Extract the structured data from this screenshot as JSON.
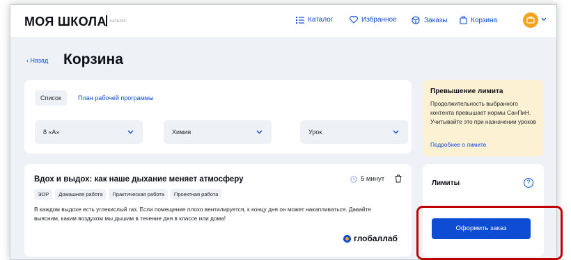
{
  "header": {
    "logo": "МОЯ ШКОЛА",
    "logo_sub": "КАТАЛОГ",
    "nav": {
      "catalog": "Каталог",
      "favorites": "Избранное",
      "orders": "Заказы",
      "cart": "Корзина"
    }
  },
  "page": {
    "back": "Назад",
    "title": "Корзина"
  },
  "filters": {
    "tabs": [
      "Список",
      "План рабочей программы"
    ],
    "selects": [
      "8 «А»",
      "Химия",
      "Урок"
    ]
  },
  "warning": {
    "title": "Превышение лимита",
    "text": "Продолжительность выбранного контента превышает нормы СанПиН. Учитывайте это при назначении уроков",
    "link": "Подробнее о лимите"
  },
  "lesson": {
    "title": "Вдох и выдох: как наше дыхание меняет атмосферу",
    "duration": "5 минут",
    "tags": [
      "ЭОР",
      "Домашняя работа",
      "Практическая работа",
      "Проектная работа"
    ],
    "description": "В каждом выдохе есть углекислый газ. Если помещение плохо вентилируется, к концу дня он может накапливаться. Давайте выясним, каким воздухом мы дышим в течение дня в классе или дома!",
    "provider": "глобаллаб"
  },
  "limits": {
    "title": "Лимиты",
    "help": "?",
    "order_button": "Оформить заказ"
  },
  "colors": {
    "accent": "#0d4cd3",
    "warning_bg": "#fdf1d3",
    "avatar": "#f4a31c",
    "highlight": "#c00000"
  }
}
